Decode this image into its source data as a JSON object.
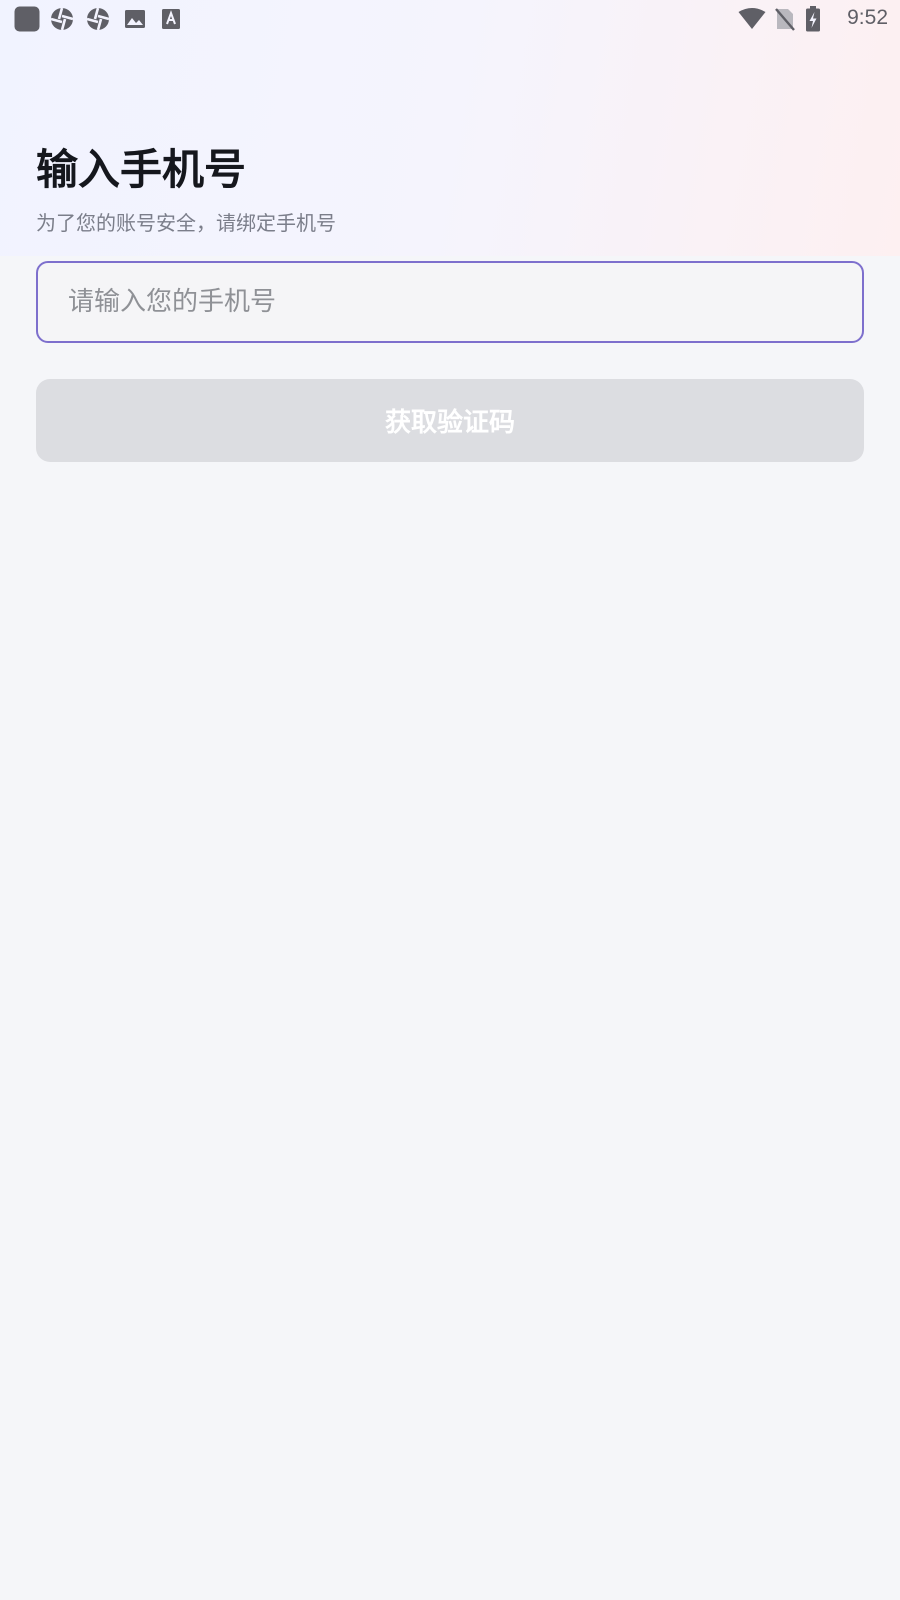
{
  "status_bar": {
    "time": "9:52",
    "left_icons": [
      "app-square-icon",
      "aperture-icon",
      "aperture-icon",
      "image-icon",
      "font-a-icon"
    ],
    "right_icons": [
      "wifi-icon",
      "no-sim-icon",
      "battery-charging-icon"
    ]
  },
  "page": {
    "title": "输入手机号",
    "subtitle": "为了您的账号安全，请绑定手机号"
  },
  "phone_input": {
    "value": "",
    "placeholder": "请输入您的手机号"
  },
  "get_code_button": {
    "label": "获取验证码",
    "enabled": false
  },
  "colors": {
    "title": "#15171d",
    "subtitle": "#7b7e8a",
    "input_border": "#7d6fcd",
    "button_disabled_bg": "#dcdde1",
    "page_bg": "#f5f6f9"
  }
}
